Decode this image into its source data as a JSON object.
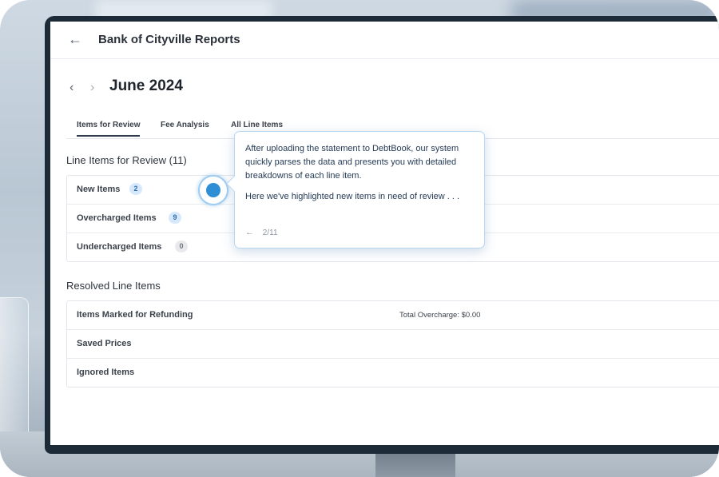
{
  "app": {
    "title": "Bank of Cityville Reports",
    "back_icon": "arrow-left-icon"
  },
  "period": {
    "month": "June 2024",
    "prev_icon": "chevron-left-icon",
    "next_icon": "chevron-right-icon"
  },
  "tabs": [
    {
      "label": "Items for Review",
      "active": true
    },
    {
      "label": "Fee Analysis",
      "active": false
    },
    {
      "label": "All Line Items",
      "active": false
    }
  ],
  "review": {
    "title": "Line Items for Review (11)",
    "rows": [
      {
        "label": "New Items",
        "count": "2",
        "badge_color": "#d6e8fb"
      },
      {
        "label": "Overcharged Items",
        "count": "9",
        "badge_color": "#d6e8fb"
      },
      {
        "label": "Undercharged Items",
        "count": "0",
        "badge_color": "#e7e9ec"
      }
    ]
  },
  "resolved": {
    "title": "Resolved Line Items",
    "rows": [
      {
        "label": "Items Marked for Refunding",
        "right_text": "Total Overcharge: $0.00"
      },
      {
        "label": "Saved Prices"
      },
      {
        "label": "Ignored Items"
      }
    ]
  },
  "tour": {
    "paragraph1": "After uploading the statement to DebtBook, our system quickly parses the data and presents you with detailed breakdowns of each line item.",
    "paragraph2": "Here we've highlighted new items in need of review . . .",
    "back_arrow": "←",
    "step": "2/11",
    "accent_color": "#2f8fd6"
  }
}
